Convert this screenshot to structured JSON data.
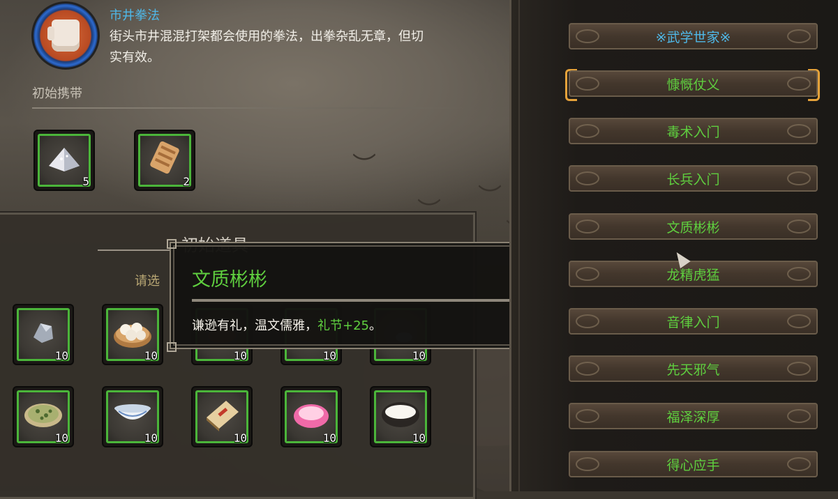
{
  "skill": {
    "name": "市井拳法",
    "desc_line1": "街头市井混混打架都会使用的拳法，出拳杂乱无章，但切",
    "desc_line2": "实有效。"
  },
  "carry": {
    "title": "初始携带",
    "items": [
      {
        "icon": "salt-pile-icon",
        "count": "5"
      },
      {
        "icon": "scroll-icon",
        "count": "2"
      }
    ]
  },
  "lower": {
    "title": "初始道具",
    "subtitle": "请选",
    "items": [
      {
        "icon": "ore-icon",
        "count": "10"
      },
      {
        "icon": "steamed-buns-icon",
        "count": "10"
      },
      {
        "icon": "bowl-dish-icon",
        "count": "10"
      },
      {
        "icon": "food-plate-icon",
        "count": "10"
      },
      {
        "icon": "herb-pouch-icon",
        "count": "10"
      },
      {
        "icon": "herb-cake-icon",
        "count": "10"
      },
      {
        "icon": "porcelain-bowl-icon",
        "count": "10"
      },
      {
        "icon": "book-icon",
        "count": "10"
      },
      {
        "icon": "pink-powder-icon",
        "count": "10"
      },
      {
        "icon": "rice-bowl-icon",
        "count": "10"
      }
    ]
  },
  "tooltip": {
    "title": "文质彬彬",
    "desc_prefix": "谦逊有礼，温文儒雅，",
    "bonus": "礼节+25",
    "desc_suffix": "。"
  },
  "talents": {
    "header": "※武学世家※",
    "items": [
      "慷慨仗义",
      "毒术入门",
      "长兵入门",
      "文质彬彬",
      "龙精虎猛",
      "音律入门",
      "先天邪气",
      "福泽深厚",
      "得心应手"
    ],
    "selected_index": 0
  },
  "colors": {
    "accent_green": "#5fcf3f",
    "accent_blue": "#4fb8e8",
    "selection_gold": "#e5a23a"
  }
}
